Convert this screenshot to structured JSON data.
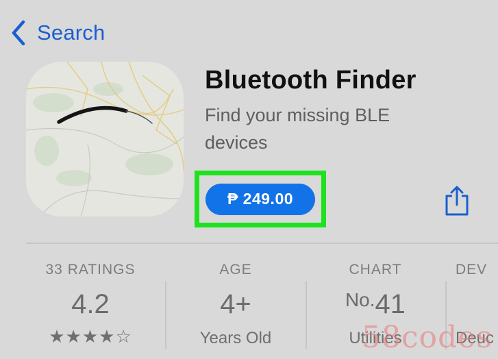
{
  "nav": {
    "back_label": "Search"
  },
  "app": {
    "title": "Bluetooth Finder",
    "subtitle": "Find your missing BLE devices",
    "price": "₱ 249.00"
  },
  "stats": [
    {
      "label": "33 RATINGS",
      "value": "4.2",
      "sub": "★★★★☆",
      "rating": 4.2
    },
    {
      "label": "AGE",
      "value": "4+",
      "sub": "Years Old"
    },
    {
      "label": "CHART",
      "value_prefix": "No.",
      "value": "41",
      "sub": "Utilities"
    },
    {
      "label": "DEV",
      "sub": "Deuc"
    }
  ],
  "icons": {
    "back": "chevron-left-icon",
    "share": "share-icon",
    "app_icon": "bluetooth-finder-app-icon"
  },
  "colors": {
    "accent": "#1273e8",
    "link": "#1a5fd0",
    "highlight": "#1fe21f"
  },
  "watermark": "58codes"
}
